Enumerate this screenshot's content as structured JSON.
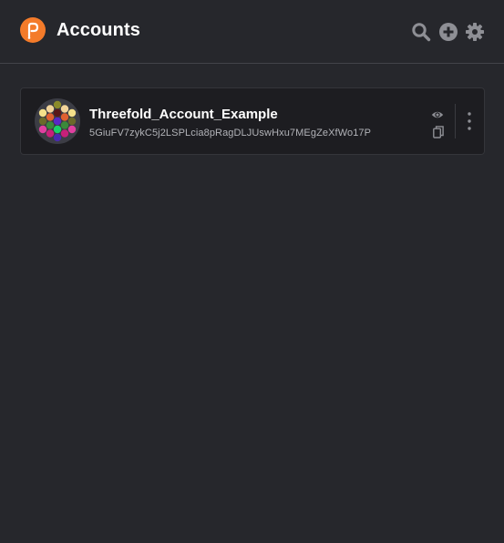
{
  "header": {
    "title": "Accounts",
    "logo_icon": "polkadot-logo-icon",
    "actions": [
      {
        "name": "search",
        "icon": "search-icon"
      },
      {
        "name": "add-account",
        "icon": "plus-circle-icon"
      },
      {
        "name": "settings",
        "icon": "gear-icon"
      }
    ]
  },
  "accounts": [
    {
      "name": "Threefold_Account_Example",
      "address": "5GiuFV7zykC5j2LSPLcia8pRagDLJUswHxu7MEgZeXfWo17P",
      "identicon": "polkadot-identicon",
      "actions": [
        "eye-icon",
        "copy-icon",
        "more-vertical-icon"
      ]
    }
  ],
  "colors": {
    "background": "#26272c",
    "card_background": "#1d1d21",
    "accent": "#f47b2a",
    "icon_gray": "#8e8f95",
    "address_text": "#b2b3b8"
  }
}
